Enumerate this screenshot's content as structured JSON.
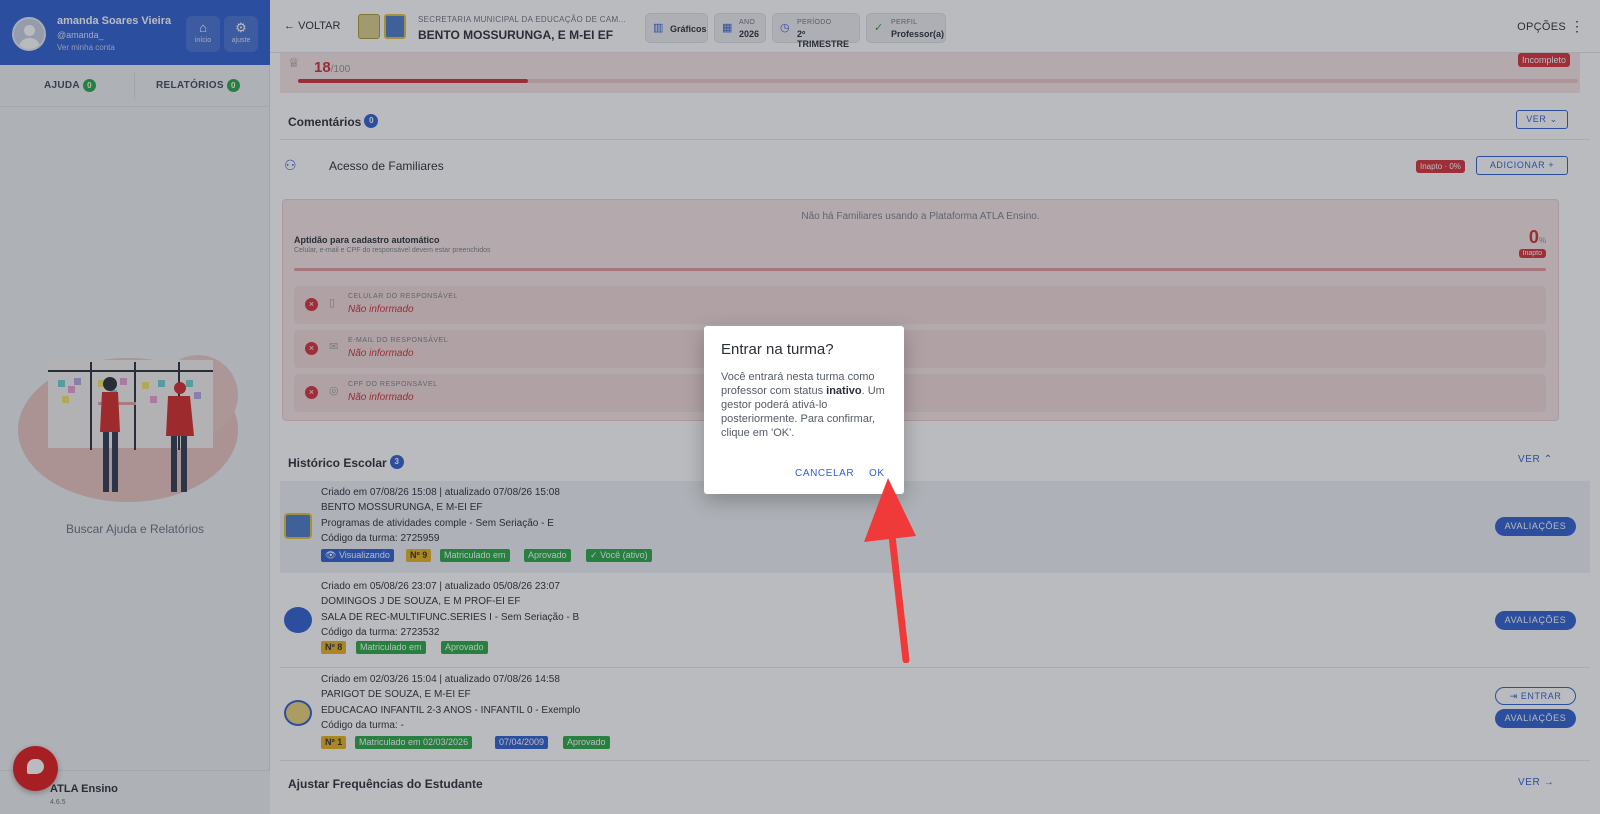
{
  "sidebar": {
    "user_name": "amanda Soares Vieira",
    "user_handle": "@amanda_",
    "user_link": "Ver minha conta",
    "btn_home": "início",
    "btn_settings": "ajuste",
    "tab_help": "AJUDA",
    "tab_help_count": "0",
    "tab_reports": "RELATÓRIOS",
    "tab_reports_count": "0",
    "help_caption": "Buscar Ajuda e Relatórios",
    "brand_name": "ATLA Ensino",
    "brand_version": "4.6.5"
  },
  "header": {
    "back": "VOLTAR",
    "school_sub": "SECRETARIA MUNICIPAL DA EDUCAÇÃO DE CAM...",
    "school_name": "BENTO MOSSURUNGA, E M-EI EF",
    "chip_charts": "Gráficos",
    "chip_year_label": "ANO",
    "chip_year_value": "2026",
    "chip_period_label": "PERÍODO",
    "chip_period_value": "2º TRIMESTRE",
    "chip_profile_label": "PERFIL",
    "chip_profile_value": "Professor(a)",
    "options": "OPÇÕES"
  },
  "score": {
    "value": "18",
    "max": "/100",
    "status": "Incompleto",
    "progress": 0.18
  },
  "comments": {
    "title": "Comentários",
    "count": "0",
    "ver": "VER"
  },
  "family": {
    "title": "Acesso de Familiares",
    "status": "Inapto · 0%",
    "add": "ADICIONAR",
    "none_msg": "Não há Familiares usando a Plataforma ATLA Ensino.",
    "aptitude_title": "Aptidão para cadastro automático",
    "aptitude_sub": "Celular, e-mail e CPF do responsável devem estar preenchidos",
    "aptitude_pct": "0",
    "aptitude_pct_unit": "%",
    "aptitude_badge": "Inapto",
    "fields": [
      {
        "label": "CELULAR DO RESPONSÁVEL",
        "value": "Não informado",
        "icon": "phone-icon"
      },
      {
        "label": "E-MAIL DO RESPONSÁVEL",
        "value": "Não informado",
        "icon": "mail-icon"
      },
      {
        "label": "CPF DO RESPONSÁVEL",
        "value": "Não informado",
        "icon": "fingerprint-icon"
      }
    ]
  },
  "history": {
    "title": "Histórico Escolar",
    "count": "3",
    "ver": "VER",
    "rows": [
      {
        "dates": "Criado em 07/08/26 15:08 | atualizado 07/08/26 15:08",
        "school": "BENTO MOSSURUNGA, E M-EI EF",
        "program": "Programas de atividades comple - Sem Seriação - E",
        "code": "Código da turma: 2725959",
        "tags": [
          "Visualizando",
          "Nº 9",
          "Matriculado em",
          "Aprovado",
          "Você (ativo)"
        ],
        "btn": "AVALIAÇÕES"
      },
      {
        "dates": "Criado em 05/08/26 23:07 | atualizado 05/08/26 23:07",
        "school": "DOMINGOS J DE SOUZA, E M PROF-EI EF",
        "program": "SALA DE REC-MULTIFUNC.SERIES I - Sem Seriação - B",
        "code": "Código da turma: 2723532",
        "tags": [
          "Nº 8",
          "Matriculado em",
          "Aprovado"
        ],
        "btn": "AVALIAÇÕES"
      },
      {
        "dates": "Criado em 02/03/26 15:04 | atualizado 07/08/26 14:58",
        "school": "PARIGOT DE SOUZA, E M-EI EF",
        "program": "EDUCACAO INFANTIL 2-3 ANOS - INFANTIL 0 - Exemplo",
        "code": "Código da turma: -",
        "tags": [
          "Nº 1",
          "Matriculado em 02/03/2026",
          "07/04/2009",
          "Aprovado"
        ],
        "btn_enter": "ENTRAR",
        "btn": "AVALIAÇÕES"
      }
    ]
  },
  "frequency": {
    "title": "Ajustar Frequências do Estudante",
    "ver": "VER"
  },
  "dialog": {
    "title": "Entrar na turma?",
    "body_1": "Você entrará nesta turma como professor com status ",
    "body_bold": "inativo",
    "body_2": ". Um gestor poderá ativá-lo posteriormente. Para confirmar, clique em 'OK'.",
    "cancel": "CANCELAR",
    "ok": "OK"
  },
  "colors": {
    "primary": "#2f5fd0",
    "danger": "#d6303a",
    "success": "#27a844",
    "warning": "#e8b31c",
    "annotation_arrow": "#f03a3a"
  }
}
